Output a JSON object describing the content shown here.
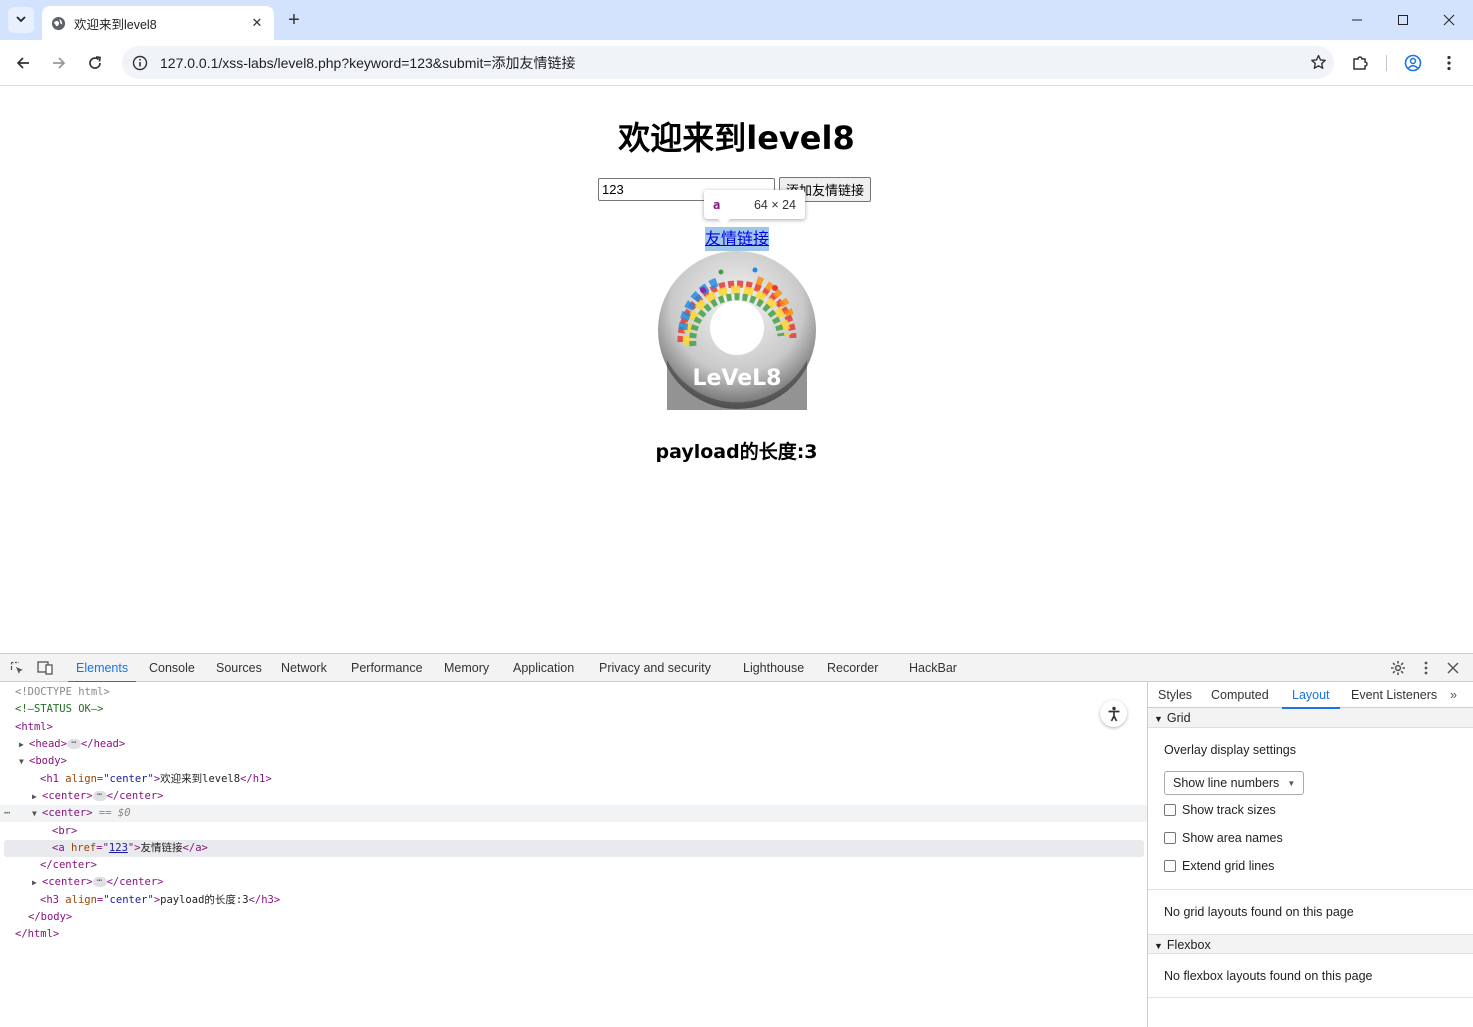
{
  "browser": {
    "tab_title": "欢迎来到level8",
    "url": "127.0.0.1/xss-labs/level8.php?keyword=123&submit=添加友情链接"
  },
  "page": {
    "heading": "欢迎来到level8",
    "keyword_value": "123",
    "submit_label": "添加友情链接",
    "friend_link_text": "友情链接",
    "payload_length_text": "payload的长度:3",
    "image_caption": "LeVeL8",
    "inspect_tooltip": {
      "tag": "a",
      "size": "64 × 24"
    }
  },
  "devtools": {
    "tabs": [
      "Elements",
      "Console",
      "Sources",
      "Network",
      "Performance",
      "Memory",
      "Application",
      "Privacy and security",
      "Lighthouse",
      "Recorder",
      "HackBar"
    ],
    "active_tab": "Elements",
    "dom": {
      "doctype": "<!DOCTYPE html>",
      "comment": "<!—STATUS OK—>",
      "html_open": "<html>",
      "head_open": "<head>",
      "head_close": "</head>",
      "body_open": "<body>",
      "h1_text": "欢迎来到level8",
      "center_open": "<center>",
      "center_close": "</center>",
      "center_marker": "== $0",
      "br": "<br>",
      "a_href": "123",
      "a_text": "友情链接",
      "h3_text": "payload的长度:3",
      "body_close": "</body>",
      "html_close": "</html>",
      "attr_align": "align",
      "attr_href": "href",
      "val_center": "\"center\""
    },
    "side_tabs": [
      "Styles",
      "Computed",
      "Layout",
      "Event Listeners"
    ],
    "active_side_tab": "Layout",
    "layout": {
      "grid_title": "Grid",
      "overlay_settings": "Overlay display settings",
      "select_value": "Show line numbers",
      "checkboxes": [
        "Show track sizes",
        "Show area names",
        "Extend grid lines"
      ],
      "no_grid_msg": "No grid layouts found on this page",
      "flexbox_title": "Flexbox",
      "no_flex_msg": "No flexbox layouts found on this page"
    }
  },
  "colors": {
    "tabbar_bg": "#d3e3fd",
    "accent": "#1a73e8",
    "link": "#0000ee",
    "highlight": "#6fa8dc"
  }
}
